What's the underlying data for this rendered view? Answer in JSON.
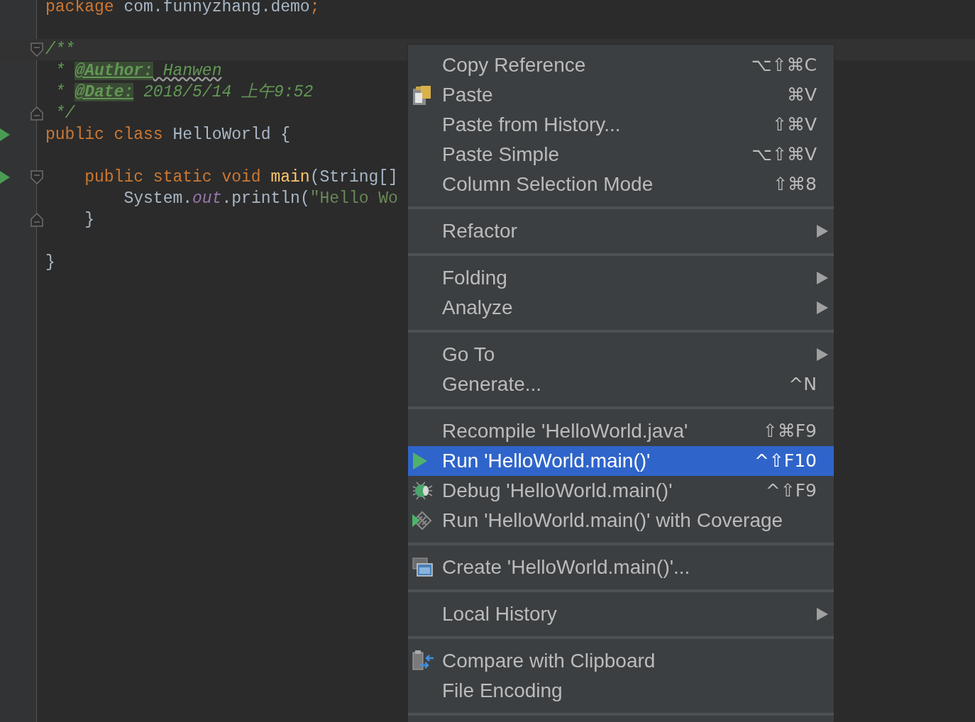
{
  "editor": {
    "lines": [
      {
        "run": false,
        "fold_start": false,
        "fold_end": false,
        "current": false,
        "tokens": [
          {
            "kind": "keyword",
            "text": "package"
          },
          {
            "kind": "plain",
            "text": " com.funnyzhang.demo"
          },
          {
            "kind": "keyword",
            "text": ";"
          }
        ]
      },
      {
        "run": false,
        "fold_start": false,
        "fold_end": false,
        "current": false
      },
      {
        "run": false,
        "fold_start": true,
        "fold_end": false,
        "current": true,
        "tokens": [
          {
            "kind": "doc",
            "text": "/**"
          }
        ]
      },
      {
        "run": false,
        "fold_start": false,
        "fold_end": false,
        "current": false,
        "tokens": [
          {
            "kind": "doc",
            "text": " * "
          },
          {
            "kind": "doctag",
            "text": "@Author:"
          },
          {
            "kind": "docvalue_typo",
            "text": " Hanwen"
          }
        ]
      },
      {
        "run": false,
        "fold_start": false,
        "fold_end": false,
        "current": false,
        "tokens": [
          {
            "kind": "doc",
            "text": " * "
          },
          {
            "kind": "doctag",
            "text": "@Date:"
          },
          {
            "kind": "docvalue",
            "text": " 2018/5/14 上午9:52"
          }
        ]
      },
      {
        "run": false,
        "fold_start": false,
        "fold_end": true,
        "current": false,
        "tokens": [
          {
            "kind": "doc",
            "text": " */"
          }
        ]
      },
      {
        "run": true,
        "fold_start": false,
        "fold_end": false,
        "current": false,
        "tokens": [
          {
            "kind": "keyword",
            "text": "public class"
          },
          {
            "kind": "plain",
            "text": " HelloWorld {"
          }
        ]
      },
      {
        "run": false,
        "fold_start": false,
        "fold_end": false,
        "current": false
      },
      {
        "run": true,
        "fold_start": true,
        "fold_end": false,
        "current": false,
        "tokens": [
          {
            "kind": "keyword",
            "text": "    public static void"
          },
          {
            "kind": "method",
            "text": " main"
          },
          {
            "kind": "plain",
            "text": "(String[]"
          }
        ]
      },
      {
        "run": false,
        "fold_start": false,
        "fold_end": false,
        "current": false,
        "tokens": [
          {
            "kind": "plain",
            "text": "        System."
          },
          {
            "kind": "field",
            "text": "out"
          },
          {
            "kind": "plain",
            "text": ".println("
          },
          {
            "kind": "string",
            "text": "\"Hello Wo"
          }
        ]
      },
      {
        "run": false,
        "fold_start": false,
        "fold_end": true,
        "current": false,
        "tokens": [
          {
            "kind": "plain",
            "text": "    }"
          }
        ]
      },
      {
        "run": false,
        "fold_start": false,
        "fold_end": false,
        "current": false
      },
      {
        "run": false,
        "fold_start": false,
        "fold_end": false,
        "current": false,
        "tokens": [
          {
            "kind": "plain",
            "text": "}"
          }
        ]
      }
    ]
  },
  "context_menu": {
    "groups": [
      [
        {
          "kind": "plain",
          "label": "Copy Reference",
          "shortcut": "⌥⇧⌘C",
          "submenu": false,
          "selected": false
        },
        {
          "kind": "paste",
          "label": "Paste",
          "shortcut": "⌘V",
          "submenu": false,
          "selected": false
        },
        {
          "kind": "plain",
          "label": "Paste from History...",
          "shortcut": "⇧⌘V",
          "submenu": false,
          "selected": false
        },
        {
          "kind": "plain",
          "label": "Paste Simple",
          "shortcut": "⌥⇧⌘V",
          "submenu": false,
          "selected": false
        },
        {
          "kind": "plain",
          "label": "Column Selection Mode",
          "shortcut": "⇧⌘8",
          "submenu": false,
          "selected": false
        }
      ],
      [
        {
          "kind": "plain",
          "label": "Refactor",
          "submenu": true,
          "selected": false
        }
      ],
      [
        {
          "kind": "plain",
          "label": "Folding",
          "submenu": true,
          "selected": false
        },
        {
          "kind": "plain",
          "label": "Analyze",
          "submenu": true,
          "selected": false
        }
      ],
      [
        {
          "kind": "plain",
          "label": "Go To",
          "submenu": true,
          "selected": false
        },
        {
          "kind": "plain",
          "label": "Generate...",
          "shortcut": "^N",
          "submenu": false,
          "selected": false
        }
      ],
      [
        {
          "kind": "plain",
          "label": "Recompile 'HelloWorld.java'",
          "shortcut": "⇧⌘F9",
          "submenu": false,
          "selected": false
        },
        {
          "kind": "run",
          "label": "Run 'HelloWorld.main()'",
          "shortcut": "^⇧F10",
          "submenu": false,
          "selected": true
        },
        {
          "kind": "debug",
          "label": "Debug 'HelloWorld.main()'",
          "shortcut": "^⇧F9",
          "submenu": false,
          "selected": false
        },
        {
          "kind": "coverage",
          "label": "Run 'HelloWorld.main()' with Coverage",
          "submenu": false,
          "selected": false
        }
      ],
      [
        {
          "kind": "create",
          "label": "Create 'HelloWorld.main()'...",
          "submenu": false,
          "selected": false
        }
      ],
      [
        {
          "kind": "plain",
          "label": "Local History",
          "submenu": true,
          "selected": false
        }
      ],
      [
        {
          "kind": "compare",
          "label": "Compare with Clipboard",
          "submenu": false,
          "selected": false
        },
        {
          "kind": "plain",
          "label": "File Encoding",
          "submenu": false,
          "selected": false
        }
      ]
    ]
  }
}
